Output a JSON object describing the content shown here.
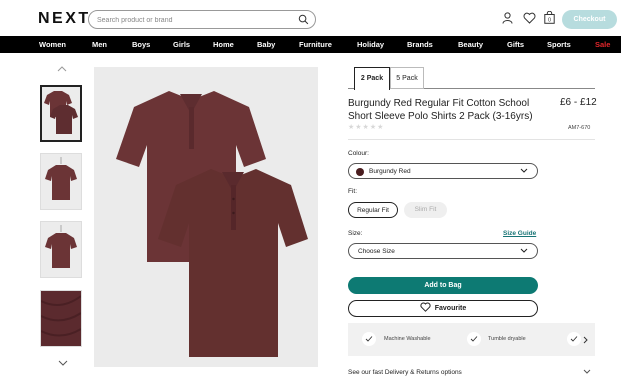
{
  "header": {
    "logo": "NEXT",
    "search_placeholder": "Search product or brand",
    "checkout_label": "Checkout"
  },
  "nav": {
    "items": [
      "Women",
      "Men",
      "Boys",
      "Girls",
      "Home",
      "Baby",
      "Furniture",
      "Holiday",
      "Brands",
      "Beauty",
      "Gifts",
      "Sports",
      "Sale"
    ]
  },
  "product": {
    "tabs": [
      "2 Pack",
      "5 Pack"
    ],
    "title": "Burgundy Red Regular Fit Cotton School Short Sleeve Polo Shirts 2 Pack (3-16yrs)",
    "price": "£6 - £12",
    "rating_stars": "★★★★★",
    "code": "AM7-670",
    "colour_label": "Colour:",
    "colour_value": "Burgundy Red",
    "colour_hex": "#4a1d1f",
    "fit_label": "Fit:",
    "fit_options": [
      "Regular Fit",
      "Slim Fit"
    ],
    "fit_selected": "Regular Fit",
    "size_label": "Size:",
    "size_guide": "Size Guide",
    "size_placeholder": "Choose Size",
    "add_to_bag": "Add to Bag",
    "favourite": "Favourite",
    "features": [
      "Machine Washable",
      "Tumble dryable"
    ],
    "delivery": "See our fast Delivery & Returns options"
  },
  "colors": {
    "accent": "#0d7a73",
    "checkout_bg": "#b7dcde",
    "nav_bg": "#000000",
    "sale": "#e3262b",
    "shirt": "#6b3436"
  },
  "icons": [
    "search-icon",
    "user-icon",
    "heart-icon",
    "bag-icon",
    "chevron-up-icon",
    "chevron-down-icon",
    "check-icon",
    "chevron-right-icon"
  ]
}
